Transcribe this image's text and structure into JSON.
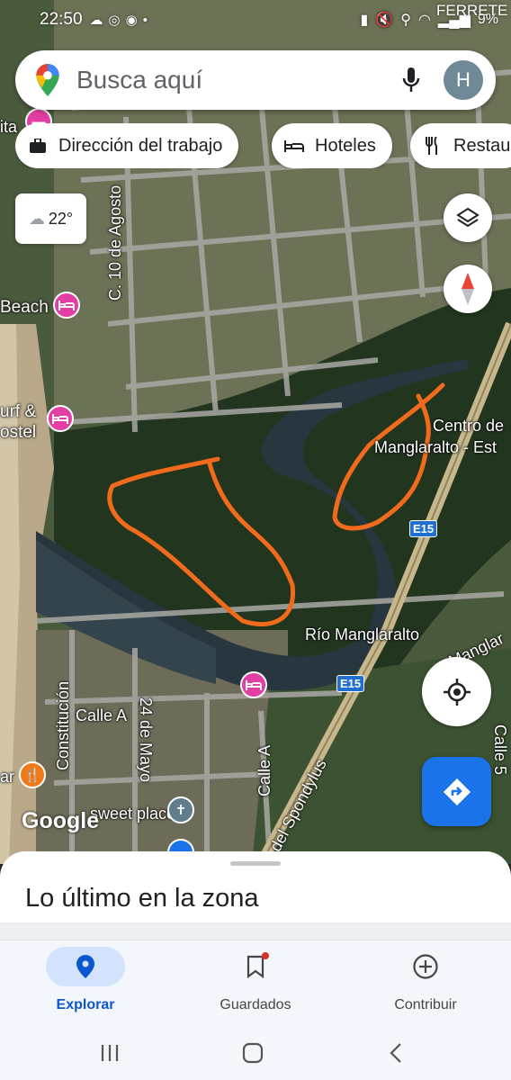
{
  "status_bar": {
    "time": "22:50",
    "carrier": "FERRETE",
    "battery": "9%",
    "icons": [
      "cloud-icon",
      "whatsapp-icon",
      "app-icon",
      "dot-icon",
      "battery-saver-icon",
      "mute-icon",
      "location-icon",
      "wifi-icon",
      "signal-icon"
    ]
  },
  "search": {
    "placeholder": "Busca aquí",
    "avatar_initial": "H",
    "icons": [
      "maps-pin-icon",
      "mic-icon"
    ]
  },
  "chips": [
    {
      "label": "Dirección del trabajo",
      "icon": "briefcase-icon"
    },
    {
      "label": "Hoteles",
      "icon": "bed-icon"
    },
    {
      "label": "Restau",
      "icon": "fork-knife-icon"
    }
  ],
  "weather": {
    "temperature": "22°",
    "icon": "cloud-icon"
  },
  "map": {
    "labels": {
      "place_partial": "ita",
      "street_10_agosto": "C. 10 de Agosto",
      "beach": "Beach",
      "surf_line1": "urf &",
      "surf_line2": "ostel",
      "centro_line1": "Centro de",
      "centro_line2": "Manglaralto - Est",
      "rio": "Río Manglaralto",
      "e15_a": "E15",
      "e15_b": "E15",
      "manglar_road": "Manglar",
      "calle_a_1": "Calle A",
      "calle_a_2": "Calle A",
      "constitucion": "Constitución",
      "veinticuatro_mayo": "24 de Mayo",
      "calle5": "Calle 5",
      "spondylus": "del Spondylus",
      "sweet_place": "sweet place",
      "ar_partial": "ar",
      "google": "Google"
    },
    "colors": {
      "annotation": "#f26b1d",
      "river": "#2a3a45",
      "road": "#c7b78a"
    }
  },
  "sheet": {
    "title": "Lo último en la zona"
  },
  "bottom_nav": [
    {
      "label": "Explorar",
      "icon": "explore-pin-icon",
      "active": true
    },
    {
      "label": "Guardados",
      "icon": "bookmark-icon",
      "active": false
    },
    {
      "label": "Contribuir",
      "icon": "add-circle-icon",
      "active": false
    }
  ],
  "system_nav": [
    "recents-icon",
    "home-icon",
    "back-icon"
  ]
}
